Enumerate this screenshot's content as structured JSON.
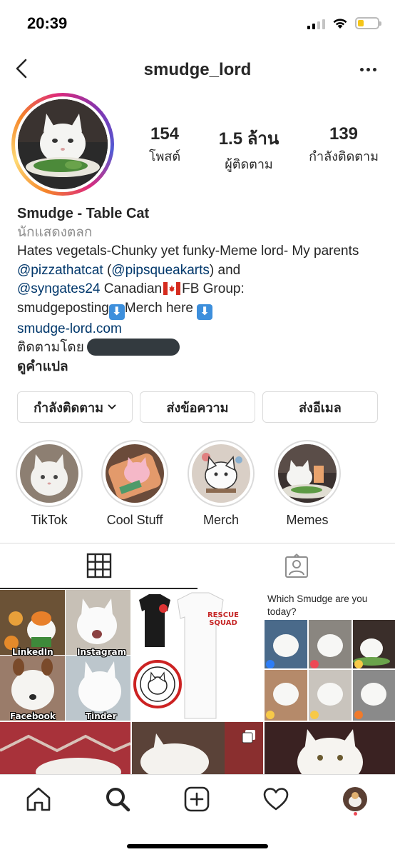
{
  "status_bar": {
    "time": "20:39"
  },
  "header": {
    "username": "smudge_lord",
    "back_icon": "chevron-left-icon",
    "more_icon": "more-horizontal-icon"
  },
  "stats": {
    "posts": {
      "value": "154",
      "label": "โพสต์"
    },
    "followers": {
      "value": "1.5 ล้าน",
      "label": "ผู้ติดตาม"
    },
    "following": {
      "value": "139",
      "label": "กำลังติดตาม"
    }
  },
  "bio": {
    "name": "Smudge - Table Cat",
    "category": "นักแสดงตลก",
    "line1": "Hates vegetals-Chunky yet funky-Meme lord- My parents ",
    "mention1": "@pizzathatcat",
    "line2a": " (",
    "mention2": "@pipsqueakarts",
    "line2b": ") and",
    "mention3": "@syngates24",
    "line3": " Canadian",
    "line3b": "FB Group:",
    "line4": "smudgeposting",
    "line4b": "Merch here ",
    "website": "smudge-lord.com",
    "followed_by": "ติดตามโดย",
    "translate": "ดูคำแปล"
  },
  "actions": {
    "following": "กำลังติดตาม",
    "message": "ส่งข้อความ",
    "email": "ส่งอีเมล"
  },
  "highlights": [
    {
      "label": "TikTok"
    },
    {
      "label": "Cool Stuff"
    },
    {
      "label": "Merch"
    },
    {
      "label": "Memes"
    }
  ],
  "grid": {
    "post1_captions": [
      "LinkedIn",
      "Instagram",
      "Facebook",
      "Tinder"
    ],
    "post2_shirt_text": "RESCUE SQUAD",
    "post3_title": "Which Smudge are you today?"
  },
  "colors": {
    "link": "#00376b",
    "accent_red": "#ed4956",
    "secondary_text": "#8e8e8e"
  }
}
